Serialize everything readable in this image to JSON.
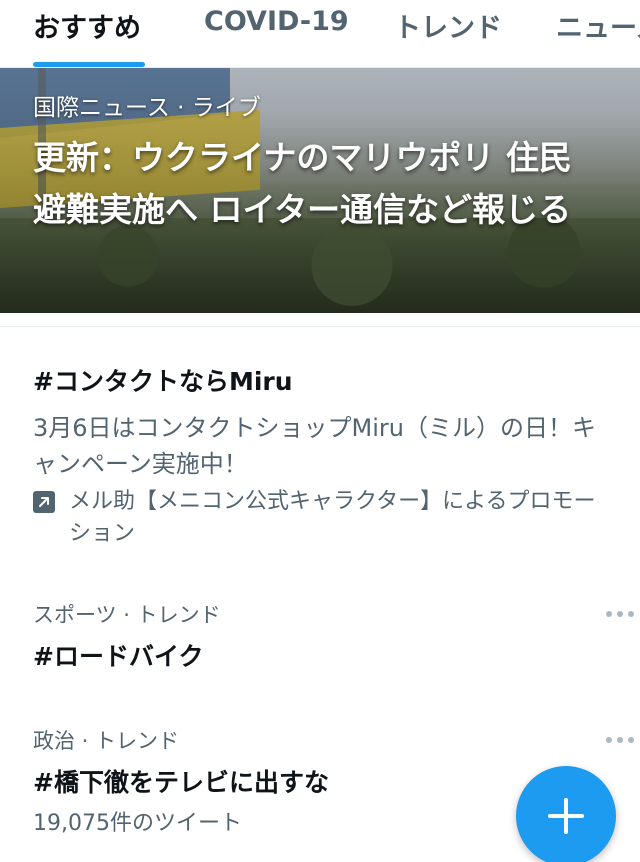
{
  "tabs": [
    {
      "label": "おすすめ",
      "active": true
    },
    {
      "label": "COVID-19",
      "active": false
    },
    {
      "label": "トレンド",
      "active": false
    },
    {
      "label": "ニュース",
      "active": false
    }
  ],
  "hero": {
    "meta": "国際ニュース · ライブ",
    "title": "更新：ウクライナのマリウポリ 住民避難実施へ ロイター通信など報じる"
  },
  "promoted": {
    "title": "#コンタクトならMiru",
    "description": "3月6日はコンタクトショップMiru（ミル）の日！キャンペーン実施中！",
    "promoted_by": "メル助【メニコン公式キャラクター】によるプロモーション"
  },
  "trends": [
    {
      "meta": "スポーツ · トレンド",
      "title": "#ロードバイク",
      "count": ""
    },
    {
      "meta": "政治 · トレンド",
      "title": "#橋下徹をテレビに出すな",
      "count": "19,075件のツイート"
    }
  ],
  "colors": {
    "accent": "#1d9bf0",
    "text_primary": "#0f1419",
    "text_secondary": "#536471"
  },
  "icons": {
    "promoted": "promoted-arrow-icon",
    "more": "more-dots-icon",
    "compose": "plus-icon"
  }
}
